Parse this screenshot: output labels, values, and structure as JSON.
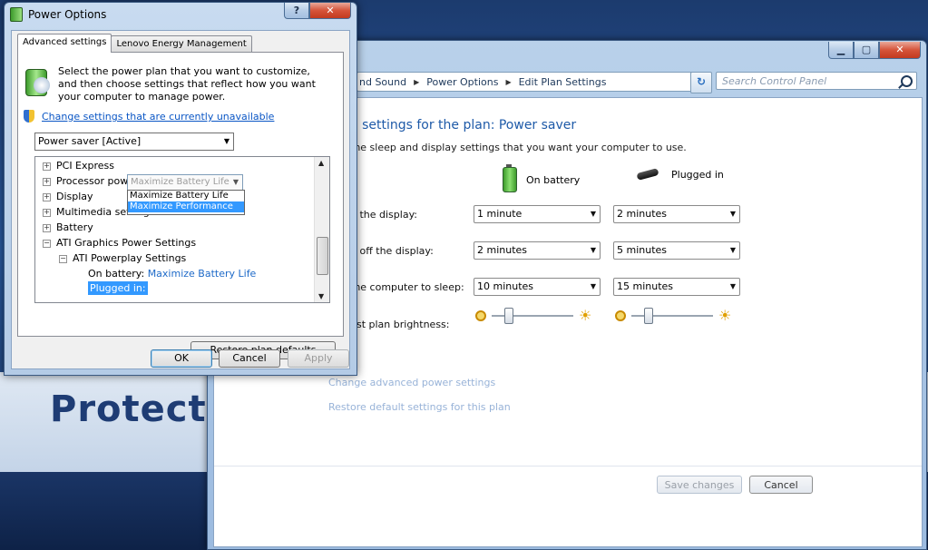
{
  "background": {
    "banner_text": "Protect n"
  },
  "control_panel": {
    "caption": {
      "minimize": "▁",
      "maximize": "▢",
      "close": "✕"
    },
    "breadcrumb": [
      "nd Sound",
      "Power Options",
      "Edit Plan Settings"
    ],
    "search_placeholder": "Search Control Panel",
    "heading": "e settings for the plan: Power saver",
    "subheading": "the sleep and display settings that you want your computer to use.",
    "col_battery": "On battery",
    "col_plugged": "Plugged in",
    "rows": [
      {
        "label": "n the display:",
        "battery": "1 minute",
        "plugged": "2 minutes"
      },
      {
        "label": "n off the display:",
        "battery": "2 minutes",
        "plugged": "5 minutes"
      },
      {
        "label": "the computer to sleep:",
        "battery": "10 minutes",
        "plugged": "15 minutes"
      }
    ],
    "brightness_label": "ust plan brightness:",
    "brightness_battery": 0.15,
    "brightness_plugged": 0.15,
    "link_advanced": "Change advanced power settings",
    "link_restore": "Restore default settings for this plan",
    "save_label": "Save changes",
    "cancel_label": "Cancel"
  },
  "power_options": {
    "title": "Power Options",
    "caption": {
      "help": "?",
      "close": "✕"
    },
    "tabs": [
      "Advanced settings",
      "Lenovo Energy Management"
    ],
    "description": "Select the power plan that you want to customize, and then choose settings that reflect how you want your computer to manage power.",
    "change_link": "Change settings that are currently unavailable",
    "plan_selected": "Power saver [Active]",
    "tree": {
      "items": [
        {
          "sign": "+",
          "label": "PCI Express"
        },
        {
          "sign": "+",
          "label": "Processor power management"
        },
        {
          "sign": "+",
          "label": "Display"
        },
        {
          "sign": "+",
          "label": "Multimedia settings"
        },
        {
          "sign": "+",
          "label": "Battery"
        },
        {
          "sign": "−",
          "label": "ATI Graphics Power Settings"
        }
      ],
      "sub_sign": "−",
      "sub_label": "ATI Powerplay Settings",
      "on_battery_label": "On battery:",
      "on_battery_value": "Maximize Battery Life",
      "plugged_label": "Plugged in:",
      "plugged_value": "Maximize Battery Life",
      "dropdown_options": [
        "Maximize Battery Life",
        "Maximize Performance"
      ]
    },
    "restore_label": "Restore plan defaults",
    "ok_label": "OK",
    "cancel_label": "Cancel",
    "apply_label": "Apply"
  }
}
